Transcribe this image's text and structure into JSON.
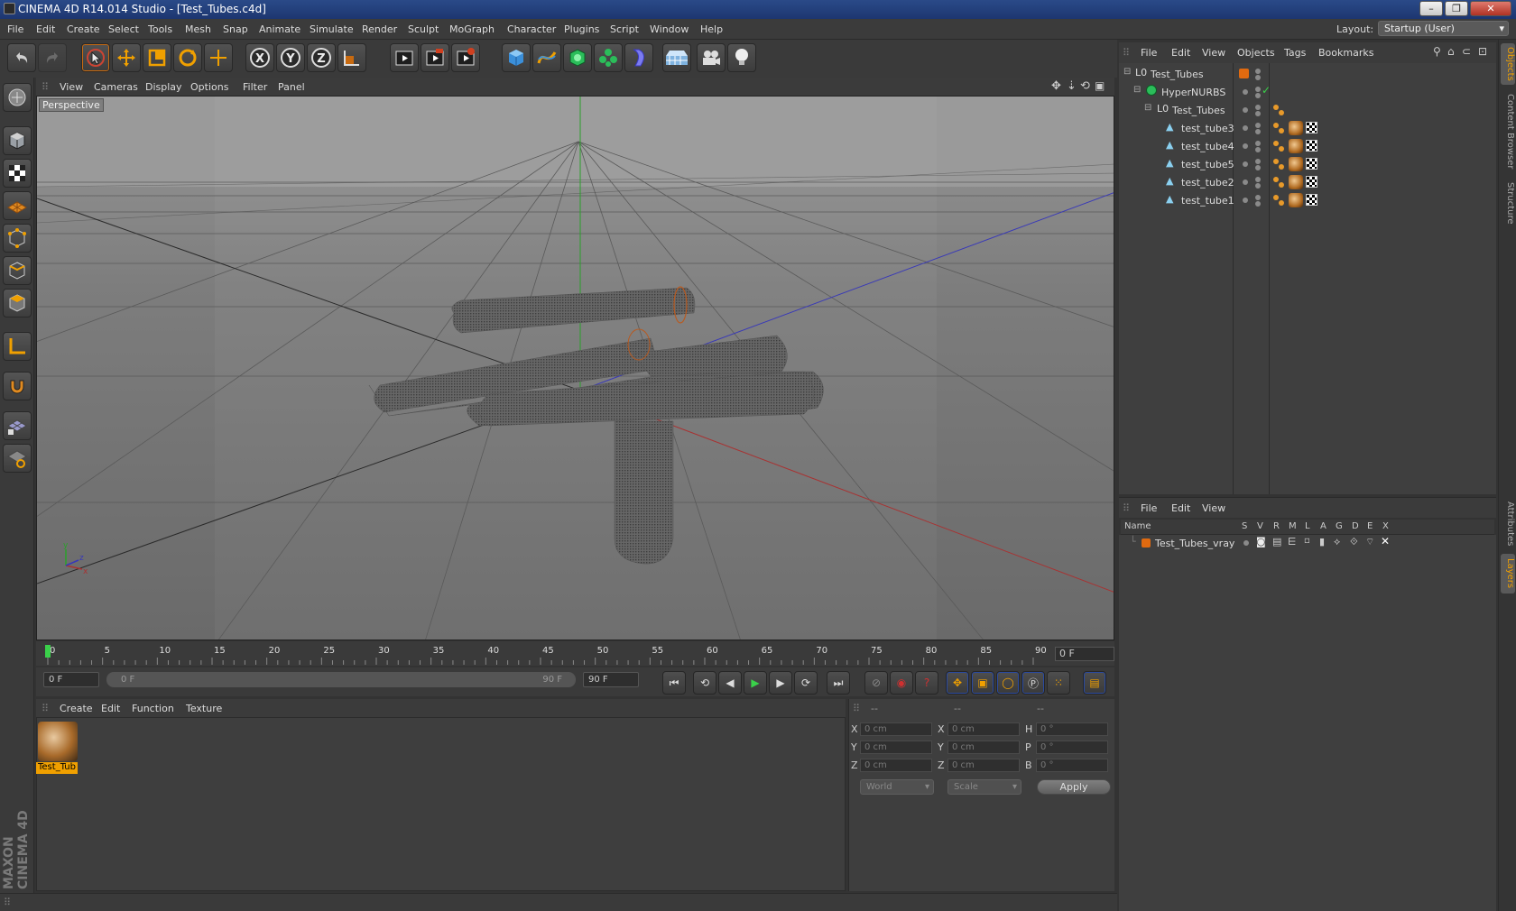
{
  "window": {
    "title": "CINEMA 4D R14.014 Studio - [Test_Tubes.c4d]",
    "controls": {
      "minimize": "–",
      "restore": "❐",
      "close": "✕"
    }
  },
  "menubar": {
    "items": [
      "File",
      "Edit",
      "Create",
      "Select",
      "Tools",
      "Mesh",
      "Snap",
      "Animate",
      "Simulate",
      "Render",
      "Sculpt",
      "MoGraph",
      "Character",
      "Plugins",
      "Script",
      "Window",
      "Help"
    ],
    "layout_label": "Layout:",
    "layout_value": "Startup (User)"
  },
  "toolbar": {
    "icons": [
      "undo-icon",
      "redo-icon",
      "live-selection-icon",
      "move-icon",
      "scale-icon",
      "rotate-icon",
      "add-icon",
      "x-axis-lock-icon",
      "y-axis-lock-icon",
      "z-axis-lock-icon",
      "coordinate-system-icon",
      "render-view-icon",
      "render-picture-viewer-icon",
      "render-settings-icon",
      "cube-icon",
      "spline-icon",
      "nurbs-icon",
      "mograph-cloner-icon",
      "deformer-icon",
      "floor-icon",
      "camera-icon",
      "light-icon"
    ],
    "axis_labels": [
      "X",
      "Y",
      "Z"
    ]
  },
  "viewport": {
    "menu": [
      "View",
      "Cameras",
      "Display",
      "Options",
      "Filter",
      "Panel"
    ],
    "label": "Perspective",
    "axis_labels": {
      "y": "y",
      "z": "z",
      "x": "x"
    }
  },
  "timeline": {
    "ticks": [
      "0",
      "5",
      "10",
      "15",
      "20",
      "25",
      "30",
      "35",
      "40",
      "45",
      "50",
      "55",
      "60",
      "65",
      "70",
      "75",
      "80",
      "85",
      "90"
    ],
    "current_frame": "0 F",
    "start_field": "0 F",
    "range_start": "0 F",
    "range_end": "90 F",
    "end_field": "90 F"
  },
  "material_manager": {
    "menu": [
      "Create",
      "Edit",
      "Function",
      "Texture"
    ],
    "materials": [
      {
        "name": "Test_Tub"
      }
    ]
  },
  "coordinates": {
    "headers": [
      "--",
      "--",
      "--"
    ],
    "rows": [
      {
        "axis": "X",
        "pos": "0 cm",
        "axis2": "X",
        "size": "0 cm",
        "rot_axis": "H",
        "rot": "0 °"
      },
      {
        "axis": "Y",
        "pos": "0 cm",
        "axis2": "Y",
        "size": "0 cm",
        "rot_axis": "P",
        "rot": "0 °"
      },
      {
        "axis": "Z",
        "pos": "0 cm",
        "axis2": "Z",
        "size": "0 cm",
        "rot_axis": "B",
        "rot": "0 °"
      }
    ],
    "mode_world": "World",
    "mode_scale": "Scale",
    "apply": "Apply"
  },
  "object_manager": {
    "menu": [
      "File",
      "Edit",
      "View",
      "Objects",
      "Tags",
      "Bookmarks"
    ],
    "objects": [
      {
        "name": "Test_Tubes",
        "depth": 0,
        "type": "null"
      },
      {
        "name": "HyperNURBS",
        "depth": 1,
        "type": "hypernurbs"
      },
      {
        "name": "Test_Tubes",
        "depth": 2,
        "type": "null"
      },
      {
        "name": "test_tube3",
        "depth": 3,
        "type": "polygon"
      },
      {
        "name": "test_tube4",
        "depth": 3,
        "type": "polygon"
      },
      {
        "name": "test_tube5",
        "depth": 3,
        "type": "polygon"
      },
      {
        "name": "test_tube2",
        "depth": 3,
        "type": "polygon"
      },
      {
        "name": "test_tube1",
        "depth": 3,
        "type": "polygon"
      }
    ]
  },
  "layer_manager": {
    "menu": [
      "File",
      "Edit",
      "View"
    ],
    "columns": [
      "Name",
      "S",
      "V",
      "R",
      "M",
      "L",
      "A",
      "G",
      "D",
      "E",
      "X"
    ],
    "layers": [
      {
        "name": "Test_Tubes_vray",
        "color": "#e06a10"
      }
    ]
  },
  "right_tabs": {
    "top": [
      "Objects",
      "Content Browser",
      "Structure"
    ],
    "bottom": [
      "Attributes",
      "Layers"
    ]
  },
  "branding": {
    "maxon": "MAXON CINEMA 4D"
  },
  "colors": {
    "accent": "#f0a000",
    "selection": "#e07010",
    "axis_x": "#b03030",
    "axis_y": "#2aa02a",
    "axis_z": "#3030c0"
  }
}
